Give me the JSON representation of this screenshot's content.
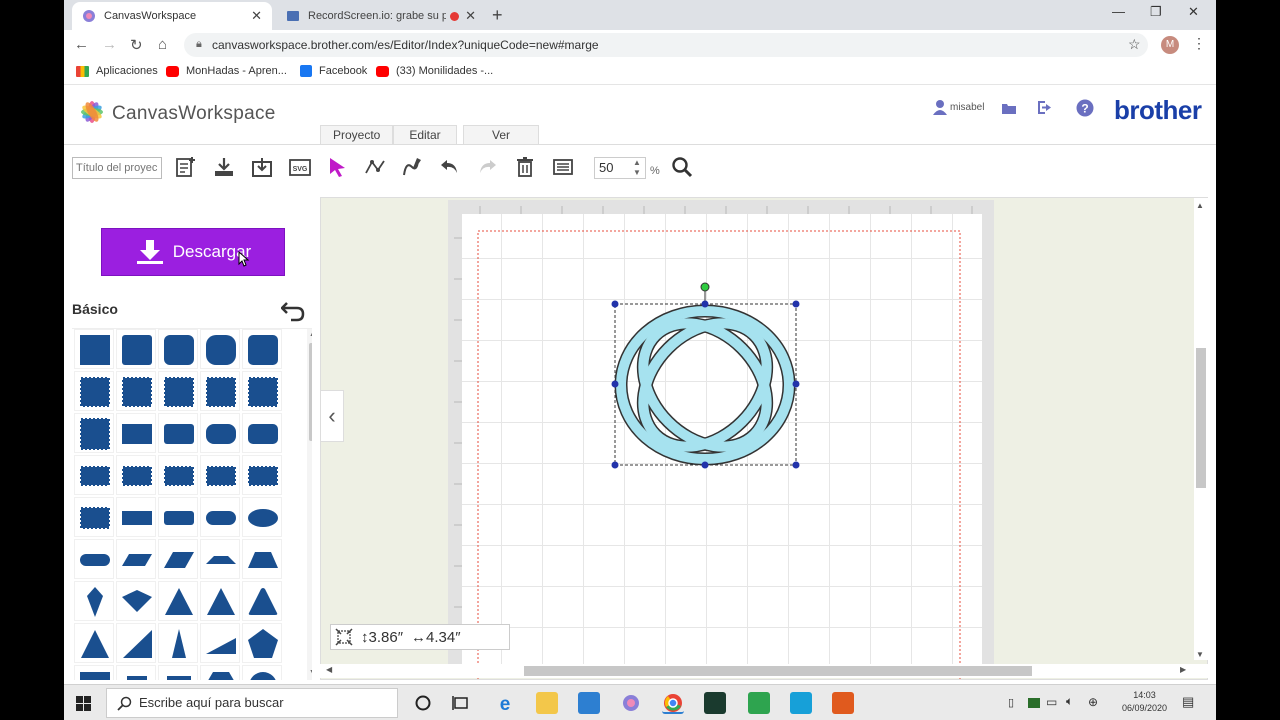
{
  "browser": {
    "tabs": [
      {
        "title": "CanvasWorkspace",
        "active": true
      },
      {
        "title": "RecordScreen.io: grabe su pa",
        "active": false
      }
    ],
    "url": "canvasworkspace.brother.com/es/Editor/Index?uniqueCode=new#marge",
    "profile_initial": "M",
    "bookmarks": [
      "Aplicaciones",
      "MonHadas - Apren...",
      "Facebook",
      "(33) Monilidades -..."
    ]
  },
  "app": {
    "logo_text": "CanvasWorkspace",
    "username": "misabel",
    "brand": "brother",
    "menu_tabs": [
      "Proyecto",
      "Editar",
      "Ver"
    ],
    "project_title_placeholder": "Título del proyec",
    "zoom": "50",
    "zoom_unit": "%"
  },
  "left_panel": {
    "download_label": "Descargar",
    "category_label": "Básico"
  },
  "canvas": {
    "height_readout": "↕3.86″",
    "width_readout": "↔4.34″"
  },
  "taskbar": {
    "search_placeholder": "Escribe aquí para buscar",
    "time": "14:03",
    "date": "06/09/2020"
  },
  "colors": {
    "accent_purple": "#9b1fe0",
    "shape_fill": "#1a4f8f",
    "selected_shape": "#a6e2ef",
    "brand_blue": "#1a3fa8"
  }
}
